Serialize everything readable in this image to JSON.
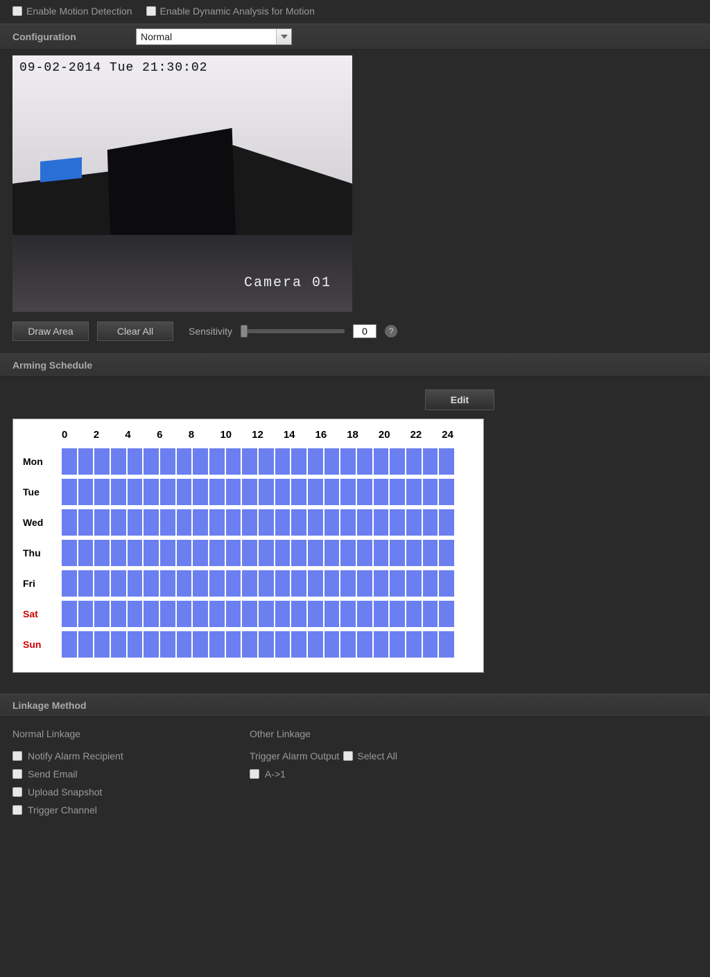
{
  "top_checks": {
    "enable_motion_label": "Enable Motion Detection",
    "enable_dynamic_label": "Enable Dynamic Analysis for Motion"
  },
  "configuration": {
    "label": "Configuration",
    "selected": "Normal"
  },
  "preview": {
    "timestamp": "09-02-2014 Tue 21:30:02",
    "camera_label": "Camera 01"
  },
  "controls": {
    "draw_area": "Draw Area",
    "clear_all": "Clear All",
    "sensitivity_label": "Sensitivity",
    "sensitivity_value": "0"
  },
  "arming_schedule": {
    "title": "Arming Schedule",
    "edit": "Edit",
    "hours": [
      "0",
      "2",
      "4",
      "6",
      "8",
      "10",
      "12",
      "14",
      "16",
      "18",
      "20",
      "22",
      "24"
    ],
    "days": [
      {
        "label": "Mon",
        "weekend": false
      },
      {
        "label": "Tue",
        "weekend": false
      },
      {
        "label": "Wed",
        "weekend": false
      },
      {
        "label": "Thu",
        "weekend": false
      },
      {
        "label": "Fri",
        "weekend": false
      },
      {
        "label": "Sat",
        "weekend": true
      },
      {
        "label": "Sun",
        "weekend": true
      }
    ]
  },
  "linkage": {
    "title": "Linkage Method",
    "normal_title": "Normal Linkage",
    "other_title": "Other Linkage",
    "normal_items": {
      "notify": "Notify Alarm Recipient",
      "email": "Send Email",
      "upload": "Upload Snapshot",
      "trigger_channel": "Trigger Channel"
    },
    "trigger_alarm_label": "Trigger Alarm Output",
    "select_all": "Select All",
    "a1": "A->1"
  }
}
